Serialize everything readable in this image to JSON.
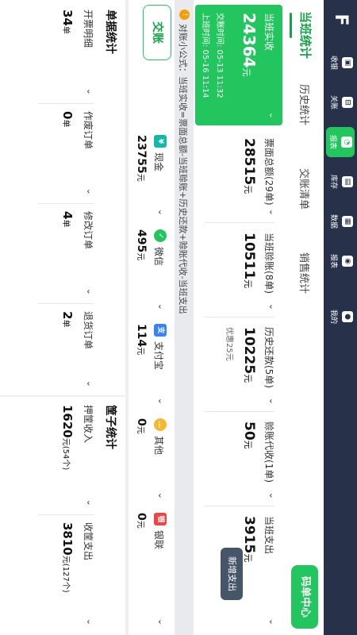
{
  "sidebar": {
    "logo": "F",
    "items": [
      {
        "label": "收银",
        "icon": "▣"
      },
      {
        "label": "关账",
        "icon": "⊟"
      },
      {
        "label": "报表",
        "icon": "◔"
      },
      {
        "label": "库存",
        "icon": "▤"
      },
      {
        "label": "数据",
        "icon": "▦"
      },
      {
        "label": "报表",
        "icon": "◉"
      },
      {
        "label": "我的",
        "icon": "●"
      }
    ]
  },
  "tabs": [
    "当班统计",
    "历史统计",
    "交账清单",
    "销售统计"
  ],
  "order_center": "码单中心",
  "summary": {
    "main_title": "当班实收",
    "main_value": "24364",
    "unit": "元",
    "items": [
      {
        "title": "票面总额(29单)",
        "value": "28515"
      },
      {
        "title": "当班赊账(8单)",
        "value": "10511"
      },
      {
        "title": "历史还款(5单)",
        "value": "10225",
        "note": "优惠25元"
      },
      {
        "title": "赊账代收(1单)",
        "value": "50"
      },
      {
        "title": "当班支出",
        "value": "3915"
      }
    ],
    "add_expense": "新增支出"
  },
  "formula": "对账小公式：当班实收=票面总额-当班赊账+历史还款+赊账代收-当班支出",
  "handover": {
    "button": "交账",
    "hand_time": "交账时间: 05-13 11:32",
    "shift_time": "上班时间: 05-16 11:14"
  },
  "payments": [
    {
      "label": "现金",
      "value": "23755",
      "icon": "¥",
      "color": "#14b8a6"
    },
    {
      "label": "微信",
      "value": "495",
      "icon": "✓",
      "color": "#22c55e"
    },
    {
      "label": "支付宝",
      "value": "114",
      "icon": "支",
      "color": "#3b82f6"
    },
    {
      "label": "其他",
      "value": "0",
      "icon": "…",
      "color": "#f5b82e"
    },
    {
      "label": "银联",
      "value": "0",
      "icon": "银",
      "color": "#ef4444"
    }
  ],
  "order_stats": {
    "title": "单据统计",
    "items": [
      {
        "label": "开票明细",
        "value": "34",
        "unit": "单"
      },
      {
        "label": "作废订单",
        "value": "0",
        "unit": "单"
      },
      {
        "label": "修改订单",
        "value": "4",
        "unit": "单"
      },
      {
        "label": "退货订单",
        "value": "2",
        "unit": "单"
      }
    ]
  },
  "basket_stats": {
    "title": "筐子统计",
    "items": [
      {
        "label": "押筐收入",
        "value": "1620",
        "unit": "元(54个)"
      },
      {
        "label": "收筐支出",
        "value": "3810",
        "unit": "元(127个)"
      }
    ]
  },
  "chevron": "⌄"
}
